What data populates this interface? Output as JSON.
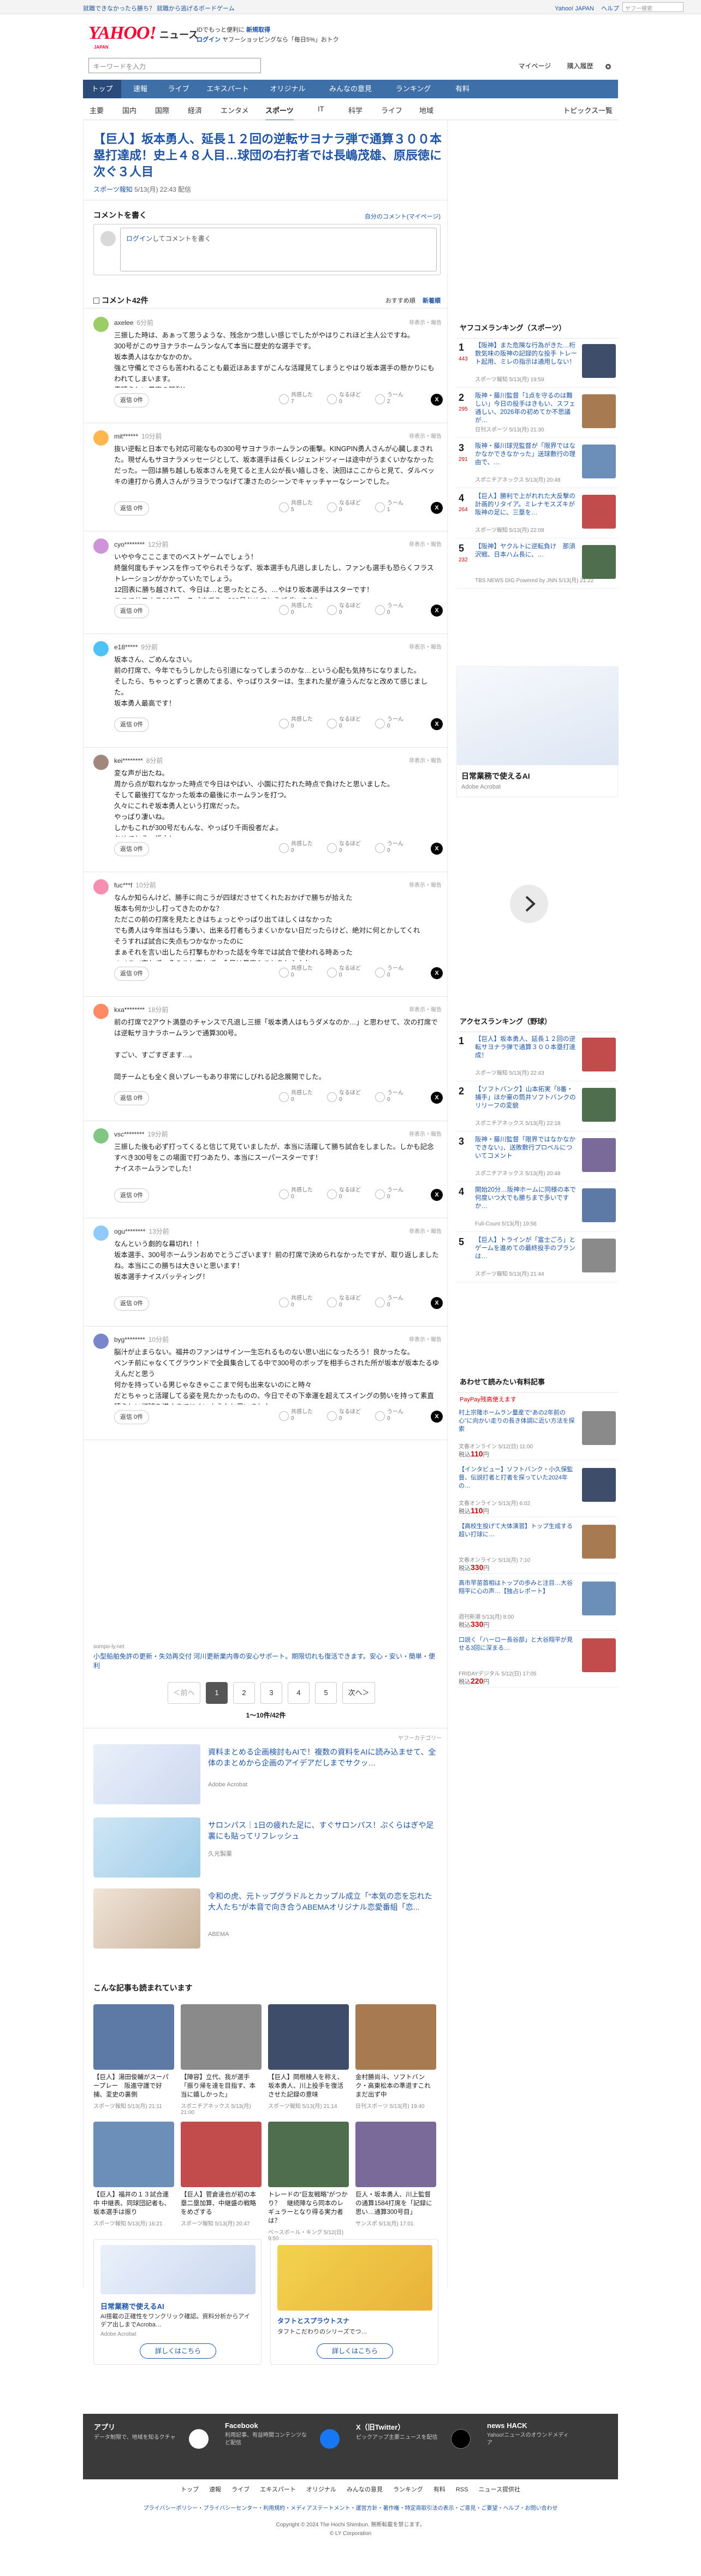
{
  "topbar": {
    "promo": "就職できなかったら勝ち？ 就職から逃げるボードゲーム",
    "links": [
      "Yahoo! JAPAN",
      "ヘルプ"
    ],
    "search_placeholder": "ヤフー検索",
    "search_button": "ウェブ検索"
  },
  "header": {
    "logo": "YAHOO!",
    "logo_sub": "JAPAN",
    "news": "ニュース",
    "line1_prefix": "IDでもっと便利に",
    "line1_link": "新規取得",
    "line2_login": "ログイン",
    "line2_rest": "ヤフーショッピングなら「毎日5%」おトク"
  },
  "search": {
    "placeholder": "キーワードを入力",
    "mypage": "マイページ",
    "buy": "購入履歴"
  },
  "nav": [
    "トップ",
    "速報",
    "ライブ",
    "エキスパート",
    "オリジナル",
    "みんなの意見",
    "ランキング",
    "有料"
  ],
  "subnav": [
    "主要",
    "国内",
    "国際",
    "経済",
    "エンタメ",
    "スポーツ",
    "IT",
    "科学",
    "ライフ",
    "地域"
  ],
  "subnav_topics": "トピックス一覧",
  "article": {
    "title": "【巨人】坂本勇人、延長１２回の逆転サヨナラ弾で通算３００本塁打達成！史上４８人目…球団の右打者では長嶋茂雄、原辰徳に次ぐ３人目",
    "source": "スポーツ報知",
    "date": "5/13(月) 22:43 配信"
  },
  "comment_form": {
    "heading": "コメントを書く",
    "my_comments": "自分のコメント(マイページ)",
    "login_link": "ログイン",
    "login_text": "してコメントを書く"
  },
  "comments_meta": {
    "count": "コメント42件",
    "sort_recommended": "おすすめ順",
    "sort_new": "新着順"
  },
  "comments": [
    {
      "user": "axelee",
      "time": "6分前",
      "body": "三振した時は、あぁって思うような、残念かつ悲しい感じでしたがやはりこれほど主人公ですね。\n300号がこのサヨナラホームランなんて本当に歴史的な選手です。\n坂本勇人はなかなかのか。\n強と守備とでさらも苦われることも最近ほあますがこんな活躍見てしまうとやはり坂本選手の懸かりにもわれてしまいます。\n素晴らしい最高の勝利！",
      "replies": "返信 0件",
      "r1": "共感した\n7",
      "r2": "なるほど\n0",
      "r3": "うーん\n2"
    },
    {
      "user": "mit******",
      "time": "10分前",
      "body": "抜い逆転と日本でも対応可能なもの300号サヨナラホームランの衝撃。KINGPIN勇人さんが心臓しまされた。現ぜんもサヨナラメッセージとして、坂本選手は長くレジェンドツィーは途中がうまくいかなかっただった。一回は勝ち越しも坂本さんを見てると主人公が長い嬉しさを、決回はここからと見て、ダルベッキの連打から勇人さんがラヨラでつなげて凄さたのシーンでキャッチャーなシーンでした。",
      "replies": "返信 0件",
      "r1": "共感した\n5",
      "r2": "なるほど\n0",
      "r3": "うーん\n1"
    },
    {
      "user": "cyo********",
      "time": "12分前",
      "body": "いやや今こここまでのベストゲームでしょう！\n終盤何度もチャンスを作ってやられそうなず、坂本選手も凡退しましたし、ファンも選手も恐らくフラストレーションがかかっていたでしょう。\n12回表に勝ち越されて、今日は…と思ったところ、…やはり坂本選手はスターです！\nここでサヨナラ300号。スゴすぎる、300号おめでとうございます！",
      "replies": "返信 0件",
      "r1": "共感した\n0",
      "r2": "なるほど\n0",
      "r3": "うーん\n0"
    },
    {
      "user": "e18*****",
      "time": "9分前",
      "body": "坂本さん、ごめんなさい。\n前の打席で、今年でもうしかしたら引退になってしまうのかな…という心配も気持ちになりました。\nそしたら、ちゃっとずっと褒めてまる、やっぱりスターは、生まれた星が違うんだなと改めて感じました。\n坂本勇人最高です！",
      "replies": "返信 0件",
      "r1": "共感した\n0",
      "r2": "なるほど\n0",
      "r3": "うーん\n0"
    },
    {
      "user": "kei********",
      "time": "8分前",
      "body": "変な声が出たね。\n周から点が取れなかった時点で今日はやばい、小園に打たれた時点で負けたと思いました。\nそして最後打てなかった坂本の最後にホームランを打つ。\n久々にこれぞ坂本勇人という打席だった。\nやっぱり凄いね。\nしかもこれが300号だもんな、やっぱり千両役者だよ。\nおめでとう、坂本！",
      "replies": "返信 0件",
      "r1": "共感した\n0",
      "r2": "なるほど\n0",
      "r3": "うーん\n0"
    },
    {
      "user": "fuc***f",
      "time": "10分前",
      "body": "なんか知らんけど、勝手に向こうが四球ださせてくれたおかげで勝ちが拾えた\n坂本も何か少し打ってきたのかな？\nただこの前の打席を見たときはちょっとやっぱり出てほしくはなかった\nでも勇人は今年当はもう凄い、出来る打者もうまくいかない日だったらけど、絶対に何とかしてくれ\nそうすれば試合に失点もつかなかったのに\nまぁそれを言い出したら打撃もかわった話を今年では試合で使われる時あった\nつべこべ言わず、そのこと言わず、今日は最高なことをしたよね",
      "replies": "返信 0件",
      "r1": "共感した\n0",
      "r2": "なるほど\n0",
      "r3": "うーん\n0"
    },
    {
      "user": "kxa********",
      "time": "18分前",
      "body": "前の打席で2アウト満塁のチャンスで凡退し三振「坂本勇人はもうダメなのか…」と思わせて、次の打席では逆転サヨナラホームランで通算300号。\n\nすごい、すごすぎます…。\n\n岡チームとも全く良いプレーもあり非常にしびれる記念展開でした。\n\n両チームともお疲れ様でした！",
      "replies": "返信 0件",
      "r1": "共感した\n0",
      "r2": "なるほど\n0",
      "r3": "うーん\n0"
    },
    {
      "user": "vsc********",
      "time": "19分前",
      "body": "三振した後も必ず打ってくると信じて見ていましたが、本当に活躍して勝ち試合をしました。しかも記念すべき300号をこの場面で打つあたり、本当にスーパースターです！\nナイスホームランでした！",
      "replies": "返信 0件",
      "r1": "共感した\n0",
      "r2": "なるほど\n0",
      "r3": "うーん\n0"
    },
    {
      "user": "ogu********",
      "time": "13分前",
      "body": "なんという劇的な幕切れ！！\n坂本選手、300号ホームランおめでとうございます！前の打席で決められなかったですが、取り返しましたね。本当にこの勝ちは大きいと思います！\n坂本選手ナイスバッティング！",
      "replies": "返信 0件",
      "r1": "共感した\n0",
      "r2": "なるほど\n0",
      "r3": "うーん\n0"
    },
    {
      "user": "byg********",
      "time": "10分前",
      "body": "脳汁が止まらない。福井のファンはサイン一生忘れるものない思い出になったろう！良かったな。\nベンチ前にゃなくてグラウンドで全員集合してる中で300号のボップを相手らされた所が坂本が坂本たるゆえんだと思う\n何かを持っている男じゃなきゃここまで何も出来ないのにと時々\nだとちゃっと活躍してる姿を見たかったものの、今日でその下幸運を超えてスイングの勢いを持って素直晴らしい打球を描くまでにくいようなと思いました",
      "replies": "返信 0件",
      "r1": "共感した\n0",
      "r2": "なるほど\n0",
      "r3": "うーん\n0"
    }
  ],
  "inline_ad": {
    "source": "sompo-ly.net",
    "text": "小型船舶免許の更新・失効再交付 河川更新業内専の安心サポート。期限切れも復活できます。安心・安い・簡単・便利"
  },
  "pager": {
    "prev": "＜前へ",
    "pages": [
      "1",
      "2",
      "3",
      "4",
      "5"
    ],
    "next": "次へ＞",
    "summary": "1〜10件/42件"
  },
  "ads": [
    {
      "label": "ヤフーカテゴリー",
      "title": "資料まとめる企画検討もAIで！複数の資料をAIに読み込ませて、全体のまとめから企画のアイデアだしまでサクッ…",
      "sub": "Adobe Acrobat"
    },
    {
      "label": "",
      "title": "サロンパス｜1日の疲れた足に、すぐサロンパス！ぷくらはぎや足裏にも貼ってリフレッシュ",
      "sub": "久光製薬"
    },
    {
      "label": "",
      "title": "令和の虎、元トップグラドルとカップル成立「“本気の恋を忘れた大人たち”が本音で向き合うABEMAオリジナル恋愛番組「恋...",
      "sub": "ABEMA"
    }
  ],
  "read_more": {
    "heading": "こんな記事も読まれています",
    "cards": [
      {
        "title": "【巨人】湯田俊輔がスーパープレー　阪進守護で好捕、変史の裏側",
        "src": "スポーツ報知",
        "time": "5/13(月) 21:11"
      },
      {
        "title": "【陣容】立代、我が選手「振り帰を達を目指す、本当に嬉しかった」",
        "src": "スポニチアネックス",
        "time": "5/13(月) 21:00"
      },
      {
        "title": "【巨人】岡根稜人を称え、坂本勇人、川上投手を復活させた記録の意味",
        "src": "スポーツ報知",
        "time": "5/13(月) 21:14"
      },
      {
        "title": "金村勝尚斗、ソフトバンク・高東松本の準退すこれまだ出ず中",
        "src": "日刊スポーツ",
        "time": "5/13(月) 19:40"
      },
      {
        "title": "【巨人】福井の１３試合連中 中継表、同球団記者も、坂本選手は振り",
        "src": "スポーツ報知",
        "time": "5/13(月) 16:21"
      },
      {
        "title": "【巨人】菅倉達也が初の本塁二塁加算、中継盛の戦略をめざする",
        "src": "スポーツ報知",
        "time": "5/13(月) 20:47"
      },
      {
        "title": "トレードの“巨友戦略”がつかり？　継続陣なら同本のレギュラーとなり得る実力者は？",
        "src": "ベースボール・キング",
        "time": "5/12(日) 9:50"
      },
      {
        "title": "巨人・坂本勇人、川上監督の通算1584打席を「記録に思い…通算300号目」",
        "src": "サンスポ",
        "time": "5/13(月) 17:01"
      }
    ]
  },
  "bottom_ads": [
    {
      "title": "日常業務で使えるAI",
      "sub": "AI搭載の正確性をワンクリック確認。資料分析からアイデア出しまでAcroba…",
      "src": "Adobe Acrobat",
      "cta": "詳しくはこちら"
    },
    {
      "title": "タフトとスプラウトスナ",
      "sub": "タフトこだわりのシリーズでつ…",
      "src": "ダイハツ",
      "cta": "詳しくはこちら"
    }
  ],
  "sidebar": {
    "ranking_heading": "ヤフコメランキング（スポーツ）",
    "ranking": [
      {
        "n": "1",
        "c": "443",
        "title": "【阪神】また危険な行為がきた…桁数気味の阪神の記録的な投手 トレート起用、ミレの指示は通用しない！",
        "src": "スポーツ報知",
        "time": "5/13(月) 19:59"
      },
      {
        "n": "2",
        "c": "295",
        "title": "阪神・藤川監督「1点を守るのは難しい」今日の投手はきもい、スフェ通しい、2026年の初めてか不思議が…",
        "src": "日刊スポーツ",
        "time": "5/13(月) 21:30"
      },
      {
        "n": "3",
        "c": "291",
        "title": "阪神・藤川球児監督が「限界ではなかなかできなかった」送球敷行の理由で、…",
        "src": "スポニチアネックス",
        "time": "5/13(月) 20:48"
      },
      {
        "n": "4",
        "c": "264",
        "title": "【巨人】勝利で上がれれた大反撃の計画的リタイア。ミレナモスズキが阪神の足に、三塁を…",
        "src": "スポーツ報知",
        "time": "5/13(月) 22:08"
      },
      {
        "n": "5",
        "c": "232",
        "title": "【阪神】ヤクルトに逆転負け　那須沢戦、日本ハム長に、…",
        "src": "TBS NEWS DIG Powered by JNN",
        "time": "5/13(月) 21:22"
      }
    ],
    "ad_mid": {
      "title": "日常業務で使えるAI",
      "src": "Adobe Acrobat"
    },
    "access_heading": "アクセスランキング（野球）",
    "access": [
      {
        "n": "1",
        "title": "【巨人】坂本勇人、延長１２回の逆転サヨナラ弾で通算３００本塁打達成！",
        "src": "スポーツ報知",
        "time": "5/13(月) 22:43"
      },
      {
        "n": "2",
        "title": "【ソフトバンク】山本拓実「8番・捕手」ほか豪の筒井ソフトバンクのリリーフの変貌",
        "src": "スポニチアネックス",
        "time": "5/13(月) 22:18"
      },
      {
        "n": "3",
        "title": "阪神・藤川監督「限界ではなかなかできない」、送敗敷行プロベルについてコメント",
        "src": "スポニチアネックス",
        "time": "5/13(月) 20:48"
      },
      {
        "n": "4",
        "title": "開始20分…阪神ホームに同様の本で何度いつ大でも勝ちまで多いですか…",
        "src": "Full-Count",
        "time": "5/13(月) 19:56"
      },
      {
        "n": "5",
        "title": "【巨人】トラインが「富士ごろ」とゲームを進めての最終投手のプランは…",
        "src": "スポーツ報知",
        "time": "5/13(月) 21:44"
      }
    ],
    "shop_heading": "あわせて読みたい有料記事",
    "shop_sub": "PayPay残高使えます",
    "shop": [
      {
        "title": "村上宗隆ホームラン量産で“あの2年前の心”に向かい走りの長き体調に近い方法を探索",
        "src": "文春オンライン",
        "time": "5/12(日) 11:00",
        "price": "110"
      },
      {
        "title": "【インタビュー】ソフトバンク・小久保監督、伝説打者と打者を探っていた2024年の…",
        "src": "文春オンライン",
        "time": "5/13(月) 6:02",
        "price": "110"
      },
      {
        "title": "【高校生投げて大体演習】トップ生成する超い打球に…",
        "src": "文春オンライン",
        "time": "5/13(月) 7:10",
        "price": "330"
      },
      {
        "title": "高市早苗首相はトップの歩みと注目…大谷翔平に心の声…【独占レポート】",
        "src": "週刊新潮",
        "time": "5/13(月) 8:00",
        "price": "330"
      },
      {
        "title": "口説く「ハーロー長谷部」と大谷翔平が見せる3回に深まる…",
        "src": "FRIDAYデジタル",
        "time": "5/12(日) 17:05",
        "price": "220"
      }
    ]
  },
  "footer": {
    "cols": [
      {
        "h": "アプリ",
        "d": "データ制限で、地域を知るクチャ"
      },
      {
        "h": "Facebook",
        "d": "利用記事、有益時間コンテンツなど配信"
      },
      {
        "h": "X（旧Twitter）",
        "d": "ピックアップ主要ニュースを配信"
      },
      {
        "h": "news HACK",
        "d": "Yahoo!ニュースのオウンドメディア"
      }
    ],
    "links": [
      "トップ",
      "速報",
      "ライブ",
      "エキスパート",
      "オリジナル",
      "みんなの意見",
      "ランキング",
      "有料",
      "RSS",
      "ニュース提供社"
    ],
    "bottom": "プライバシーポリシー・プライバシーセンター・利用規約・メディアステートメント・運営方針・著作権・特定商取引法の表示・ご意見・ご要望・ヘルプ・お問い合わせ",
    "copy1": "Copyright © 2024 The Hochi Shimbun. 無断転載を禁じます。",
    "copy2": "© LY Corporation"
  }
}
